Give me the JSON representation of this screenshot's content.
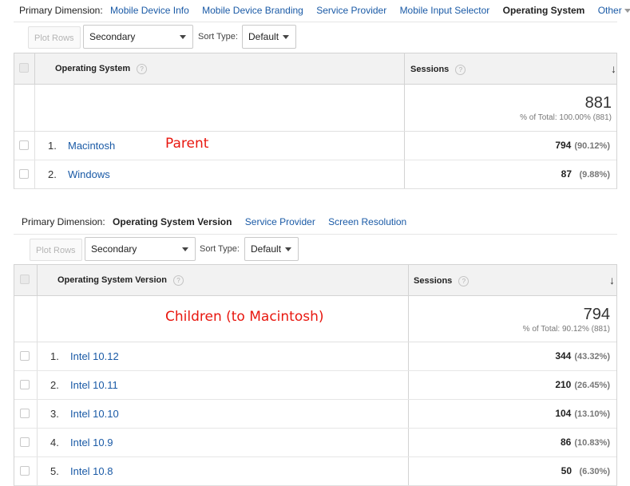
{
  "colors": {
    "link": "#1a5aa6",
    "annotation": "#e8170f"
  },
  "section1": {
    "dimension_bar": {
      "label": "Primary Dimension:",
      "items": [
        "Mobile Device Info",
        "Mobile Device Branding",
        "Service Provider",
        "Mobile Input Selector"
      ],
      "active": "Operating System",
      "other": "Other"
    },
    "toolbar": {
      "plot_rows": "Plot Rows",
      "secondary": "Secondary dimension",
      "sort_label": "Sort Type:",
      "sort_value": "Default"
    },
    "table": {
      "header_dim": "Operating System",
      "header_metric": "Sessions",
      "help_glyph": "?",
      "sort_glyph": "↓",
      "total": "881",
      "total_sub": "% of Total: 100.00% (881)",
      "rows": [
        {
          "num": "1.",
          "name": "Macintosh",
          "value": "794",
          "pct": "(90.12%)"
        },
        {
          "num": "2.",
          "name": "Windows",
          "value": "87",
          "pct": "(9.88%)"
        }
      ]
    },
    "annotation": "Parent"
  },
  "section2": {
    "dimension_bar": {
      "label": "Primary Dimension:",
      "active": "Operating System Version",
      "items": [
        "Service Provider",
        "Screen Resolution"
      ]
    },
    "toolbar": {
      "plot_rows": "Plot Rows",
      "secondary": "Secondary dimension",
      "sort_label": "Sort Type:",
      "sort_value": "Default"
    },
    "table": {
      "header_dim": "Operating System Version",
      "header_metric": "Sessions",
      "help_glyph": "?",
      "sort_glyph": "↓",
      "total": "794",
      "total_sub": "% of Total: 90.12% (881)",
      "rows": [
        {
          "num": "1.",
          "name": "Intel 10.12",
          "value": "344",
          "pct": "(43.32%)"
        },
        {
          "num": "2.",
          "name": "Intel 10.11",
          "value": "210",
          "pct": "(26.45%)"
        },
        {
          "num": "3.",
          "name": "Intel 10.10",
          "value": "104",
          "pct": "(13.10%)"
        },
        {
          "num": "4.",
          "name": "Intel 10.9",
          "value": "86",
          "pct": "(10.83%)"
        },
        {
          "num": "5.",
          "name": "Intel 10.8",
          "value": "50",
          "pct": "(6.30%)"
        }
      ]
    },
    "annotation": "Children (to Macintosh)"
  }
}
